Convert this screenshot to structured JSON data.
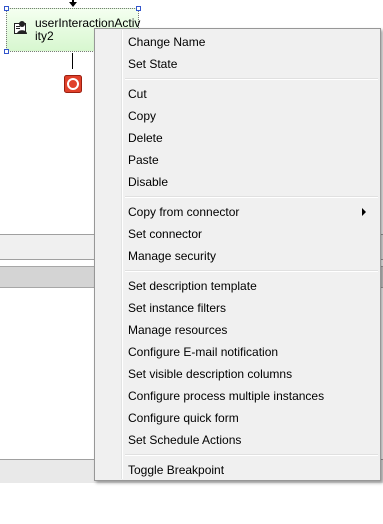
{
  "activity": {
    "label": "userInteractionActivity2",
    "icon": "user-interaction-icon",
    "stop_icon": "stop-event-icon"
  },
  "context_menu": {
    "items": [
      {
        "label": "Change Name"
      },
      {
        "label": "Set State"
      },
      {
        "label": "Cut"
      },
      {
        "label": "Copy"
      },
      {
        "label": "Delete"
      },
      {
        "label": "Paste"
      },
      {
        "label": "Disable"
      },
      {
        "label": "Copy from connector",
        "submenu": true
      },
      {
        "label": "Set connector"
      },
      {
        "label": "Manage security"
      },
      {
        "label": "Set description template"
      },
      {
        "label": "Set instance filters"
      },
      {
        "label": "Manage resources"
      },
      {
        "label": "Configure E-mail notification"
      },
      {
        "label": "Set visible description columns"
      },
      {
        "label": "Configure process multiple instances"
      },
      {
        "label": "Configure quick form"
      },
      {
        "label": "Set Schedule Actions"
      },
      {
        "label": "Toggle Breakpoint"
      }
    ]
  },
  "colors": {
    "node_fill": "#d7f7cf",
    "stop_event": "#e0402a",
    "menu_background": "#f0f0f0"
  }
}
